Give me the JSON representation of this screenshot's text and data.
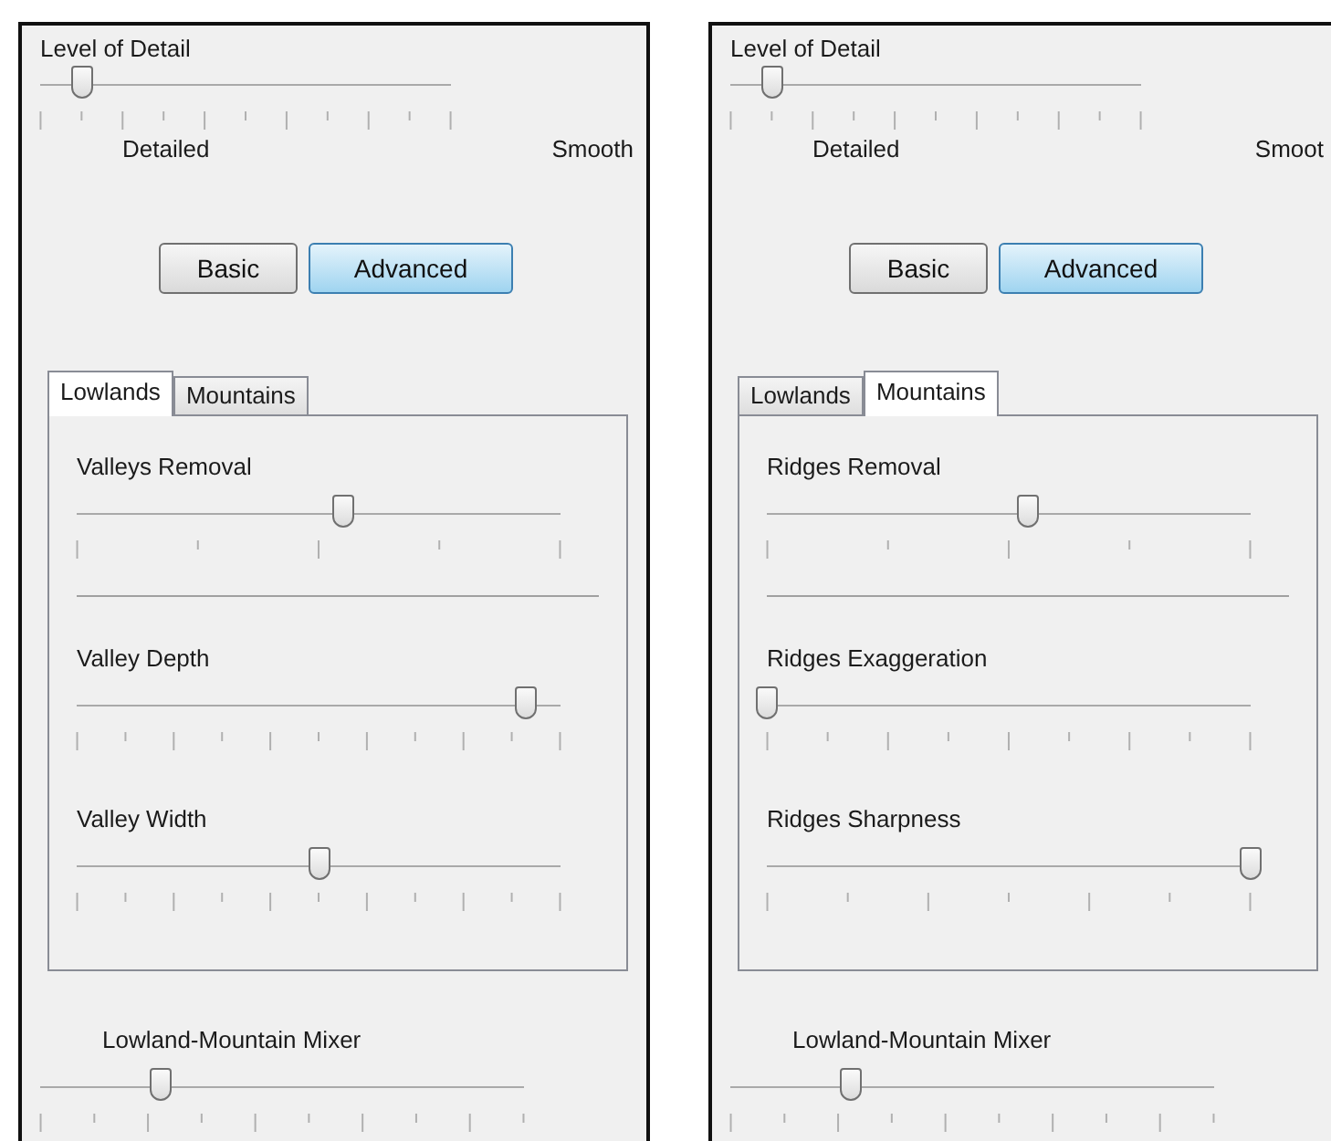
{
  "panels": [
    {
      "level_of_detail": {
        "label": "Level of Detail",
        "level": 0.1,
        "kind": "tenths",
        "min_label": "Detailed",
        "max_label": "Smooth"
      },
      "modes": [
        {
          "label": "Basic",
          "selected": false
        },
        {
          "label": "Advanced",
          "selected": true
        }
      ],
      "tabs": [
        {
          "label": "Lowlands",
          "selected": true
        },
        {
          "label": "Mountains",
          "selected": false
        }
      ],
      "sliders": [
        {
          "label": "Valleys Removal",
          "level": 0.55,
          "kind": "quarters"
        },
        {
          "label": "Valley Depth",
          "level": 0.93,
          "kind": "tenths"
        },
        {
          "label": "Valley Width",
          "level": 0.5,
          "kind": "tenths"
        }
      ],
      "mixer": {
        "label": "Lowland-Mountain Mixer",
        "level": 0.25,
        "kind": "ninths"
      }
    },
    {
      "level_of_detail": {
        "label": "Level of Detail",
        "level": 0.1,
        "kind": "tenths",
        "min_label": "Detailed",
        "max_label": "Smoot"
      },
      "modes": [
        {
          "label": "Basic",
          "selected": false
        },
        {
          "label": "Advanced",
          "selected": true
        }
      ],
      "tabs": [
        {
          "label": "Lowlands",
          "selected": false
        },
        {
          "label": "Mountains",
          "selected": true
        }
      ],
      "sliders": [
        {
          "label": "Ridges Removal",
          "level": 0.54,
          "kind": "quarters"
        },
        {
          "label": "Ridges Exaggeration",
          "level": 0,
          "kind": "eighths"
        },
        {
          "label": "Ridges Sharpness",
          "level": 1,
          "kind": "sixths"
        }
      ],
      "mixer": {
        "label": "Lowland-Mountain Mixer",
        "level": 0.25,
        "kind": "ninths"
      }
    }
  ]
}
